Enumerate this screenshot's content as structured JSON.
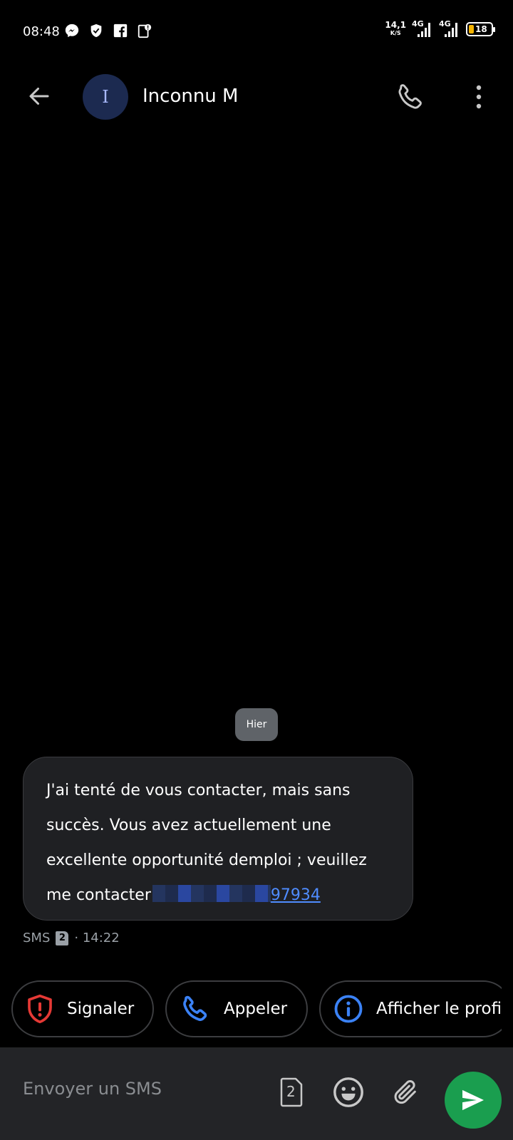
{
  "status_bar": {
    "time": "08:48",
    "net_speed_value": "14,1",
    "net_speed_unit": "K/S",
    "sim1_label": "4G",
    "sim2_label": "4G",
    "battery_level": "18",
    "battery_fill_color": "#f5b400",
    "left_icons": [
      "messenger-icon",
      "shield-check-icon",
      "facebook-icon",
      "notification-badge-icon"
    ]
  },
  "header": {
    "avatar_letter": "I",
    "contact_name": "Inconnu M",
    "avatar_color": "#1c2a50"
  },
  "conversation": {
    "date_separator": "Hier",
    "message": {
      "text": "J'ai tenté de vous contacter, mais sans succès. Vous avez actuellement une excellente opportunité demploi ; veuillez me contacter",
      "phone_visible": "97934",
      "type": "SMS",
      "sim": "2",
      "time": "· 14:22"
    }
  },
  "suggestions": [
    {
      "label": "Signaler",
      "icon": "shield-alert-icon",
      "color": "#e53935"
    },
    {
      "label": "Appeler",
      "icon": "phone-icon",
      "color": "#3b82f6"
    },
    {
      "label": "Afficher le profil",
      "icon": "info-icon",
      "color": "#3b82f6"
    }
  ],
  "composer": {
    "placeholder": "Envoyer un SMS",
    "sim_number": "2",
    "send_color": "#1a9e4f"
  }
}
